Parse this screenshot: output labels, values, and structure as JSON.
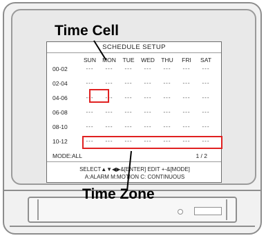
{
  "screen": {
    "title": "SCHEDULE SETUP",
    "days": [
      "SUN",
      "MON",
      "TUE",
      "WED",
      "THU",
      "FRI",
      "SAT"
    ],
    "rows": [
      {
        "label": "00-02",
        "cells": [
          "---",
          "---",
          "---",
          "---",
          "---",
          "---",
          "---"
        ]
      },
      {
        "label": "02-04",
        "cells": [
          "---",
          "---",
          "---",
          "---",
          "---",
          "---",
          "---"
        ]
      },
      {
        "label": "04-06",
        "cells": [
          "---",
          "---",
          "---",
          "---",
          "---",
          "---",
          "---"
        ]
      },
      {
        "label": "06-08",
        "cells": [
          "---",
          "---",
          "---",
          "---",
          "---",
          "---",
          "---"
        ]
      },
      {
        "label": "08-10",
        "cells": [
          "---",
          "---",
          "---",
          "---",
          "---",
          "---",
          "---"
        ]
      },
      {
        "label": "10-12",
        "cells": [
          "---",
          "---",
          "---",
          "---",
          "---",
          "---",
          "---"
        ]
      }
    ],
    "mode": "MODE:ALL",
    "page": "1 / 2",
    "footer_line1": "SELECT▲▼◀▶&[ENTER] EDIT +-&[MODE]",
    "footer_line2": "A:ALARM   M:MOTION   C: CONTINUOUS"
  },
  "annotations": {
    "time_cell": "Time Cell",
    "time_zone": "Time Zone"
  },
  "colors": {
    "highlight": "#e02020"
  }
}
